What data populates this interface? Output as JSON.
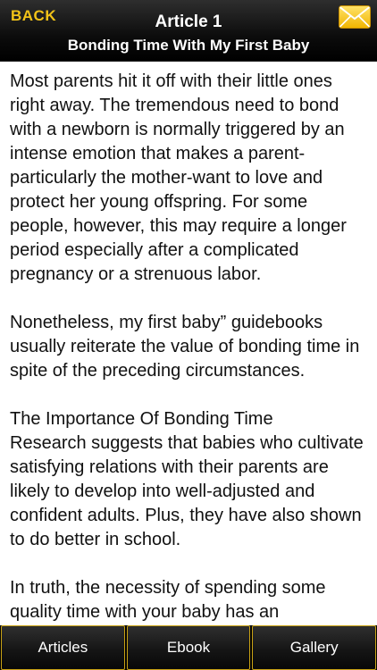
{
  "header": {
    "back_label": "BACK",
    "title": "Article 1",
    "subtitle": "Bonding Time With My First Baby",
    "mail_icon": "envelope-icon",
    "accent_color": "#f2c318"
  },
  "article": {
    "paragraphs": [
      "Most parents hit it off with their little ones right away. The tremendous need to bond with a newborn is normally triggered by an intense emotion that makes a parent-particularly the mother-want to love and protect her young offspring. For some people, however, this may require a longer period especially after a complicated pregnancy or a strenuous labor.",
      "Nonetheless, my first baby” guidebooks usually reiterate the value of bonding time in spite of the preceding circumstances.",
      "The Importance Of Bonding Time",
      "Research suggests that babies who cultivate satisfying relations with their parents are likely to develop into well-adjusted and confident adults. Plus, they have also shown to do better in school.",
      "In truth, the necessity of spending some quality time with your baby has an"
    ]
  },
  "tabs": [
    {
      "label": "Articles"
    },
    {
      "label": "Ebook"
    },
    {
      "label": "Gallery"
    }
  ]
}
